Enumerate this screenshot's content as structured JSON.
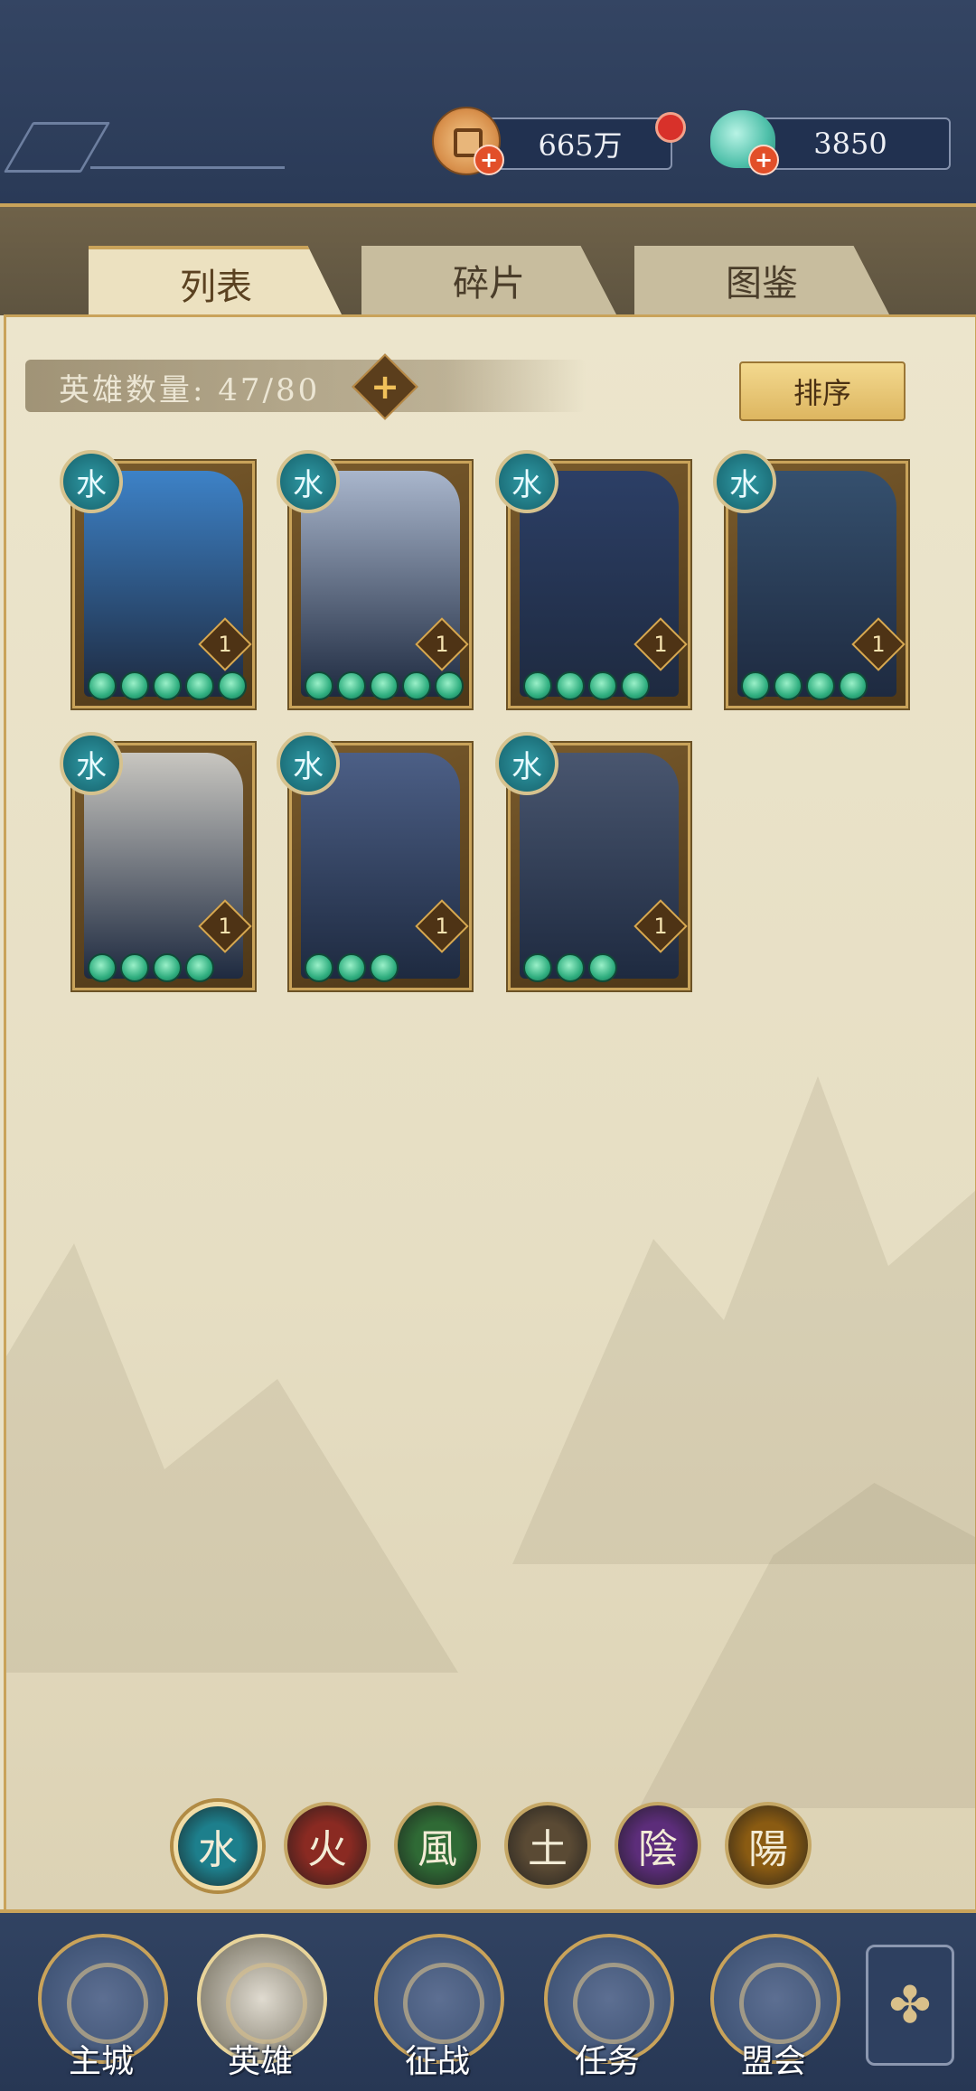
{
  "header": {
    "coins_value": "665万",
    "gems_value": "3850",
    "coin_icon": "copper-coin-icon",
    "gem_icon": "jade-gem-icon"
  },
  "tabs": [
    {
      "label": "列表",
      "active": true
    },
    {
      "label": "碎片",
      "active": false
    },
    {
      "label": "图鉴",
      "active": false
    }
  ],
  "hero_count": {
    "label": "英雄数量:",
    "value": "47/80"
  },
  "sort_button": "排序",
  "heroes": [
    {
      "element": "水",
      "level": "1",
      "stars": 5,
      "portrait_color": "#3d82c7"
    },
    {
      "element": "水",
      "level": "1",
      "stars": 5,
      "portrait_color": "#a9b6cc"
    },
    {
      "element": "水",
      "level": "1",
      "stars": 4,
      "portrait_color": "#2c3f66"
    },
    {
      "element": "水",
      "level": "1",
      "stars": 4,
      "portrait_color": "#35506e"
    },
    {
      "element": "水",
      "level": "1",
      "stars": 4,
      "portrait_color": "#c8c6c0"
    },
    {
      "element": "水",
      "level": "1",
      "stars": 3,
      "portrait_color": "#4c5f86"
    },
    {
      "element": "水",
      "level": "1",
      "stars": 3,
      "portrait_color": "#49566f"
    }
  ],
  "element_filters": [
    {
      "glyph": "水",
      "color": "#1d7f8c",
      "active": true
    },
    {
      "glyph": "火",
      "color": "#8a2a22",
      "active": false
    },
    {
      "glyph": "風",
      "color": "#2f6a35",
      "active": false
    },
    {
      "glyph": "土",
      "color": "#5a4a34",
      "active": false
    },
    {
      "glyph": "陰",
      "color": "#5c2d7a",
      "active": false
    },
    {
      "glyph": "陽",
      "color": "#8a5b12",
      "active": false
    }
  ],
  "nav": [
    {
      "label": "主城",
      "icon": "city-gate-icon",
      "active": false
    },
    {
      "label": "英雄",
      "icon": "hero-portrait-icon",
      "active": true
    },
    {
      "label": "征战",
      "icon": "battle-icon",
      "active": false
    },
    {
      "label": "任务",
      "icon": "task-scroll-icon",
      "active": false
    },
    {
      "label": "盟会",
      "icon": "alliance-pavilion-icon",
      "active": false
    }
  ],
  "nav_extra_icon": "menu-flower-icon"
}
